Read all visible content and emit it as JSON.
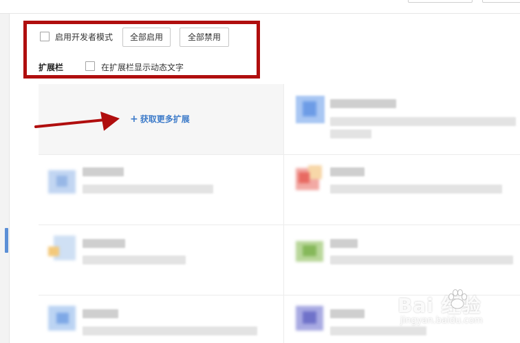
{
  "toolbar": {
    "developer_mode_label": "启用开发者模式",
    "enable_all_label": "全部启用",
    "disable_all_label": "全部禁用"
  },
  "extension_bar": {
    "title": "扩展栏",
    "show_dynamic_text_label": "在扩展栏显示动态文字"
  },
  "gallery": {
    "get_more_label": "获取更多扩展"
  },
  "colors": {
    "highlight_red": "#b00e0e",
    "link_blue": "#3d7bc9"
  },
  "watermark": {
    "brand": "Bai  经验",
    "url": "jingyan.baidu.com"
  }
}
